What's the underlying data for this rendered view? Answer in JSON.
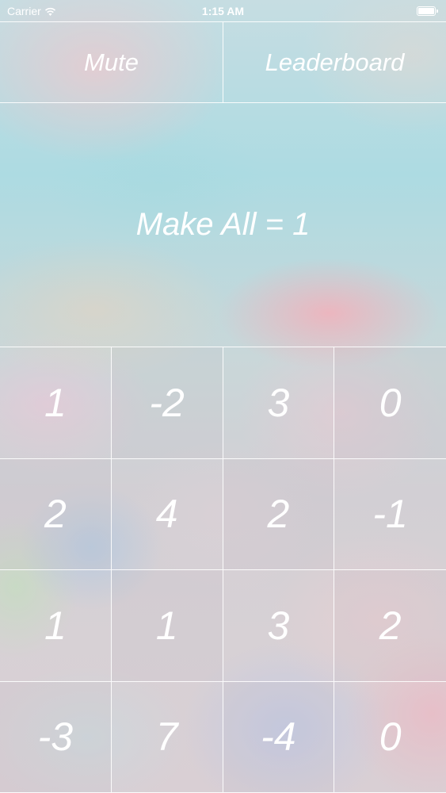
{
  "status_bar": {
    "carrier": "Carrier",
    "time": "1:15 AM",
    "icons": [
      "wifi-icon",
      "battery-icon"
    ]
  },
  "top_bar": {
    "mute_label": "Mute",
    "leaderboard_label": "Leaderboard"
  },
  "goal": {
    "text": "Make All = 1"
  },
  "board": {
    "rows": [
      [
        "1",
        "-2",
        "3",
        "0"
      ],
      [
        "2",
        "4",
        "2",
        "-1"
      ],
      [
        "1",
        "1",
        "3",
        "2"
      ],
      [
        "-3",
        "7",
        "-4",
        "0"
      ]
    ]
  },
  "colors": {
    "text": "#ffffff",
    "grid_lines": "#ffffff",
    "background_top": "#addbe2",
    "background_bottom": "#d9cfd4",
    "accent_pink": "#f3b0ba"
  }
}
